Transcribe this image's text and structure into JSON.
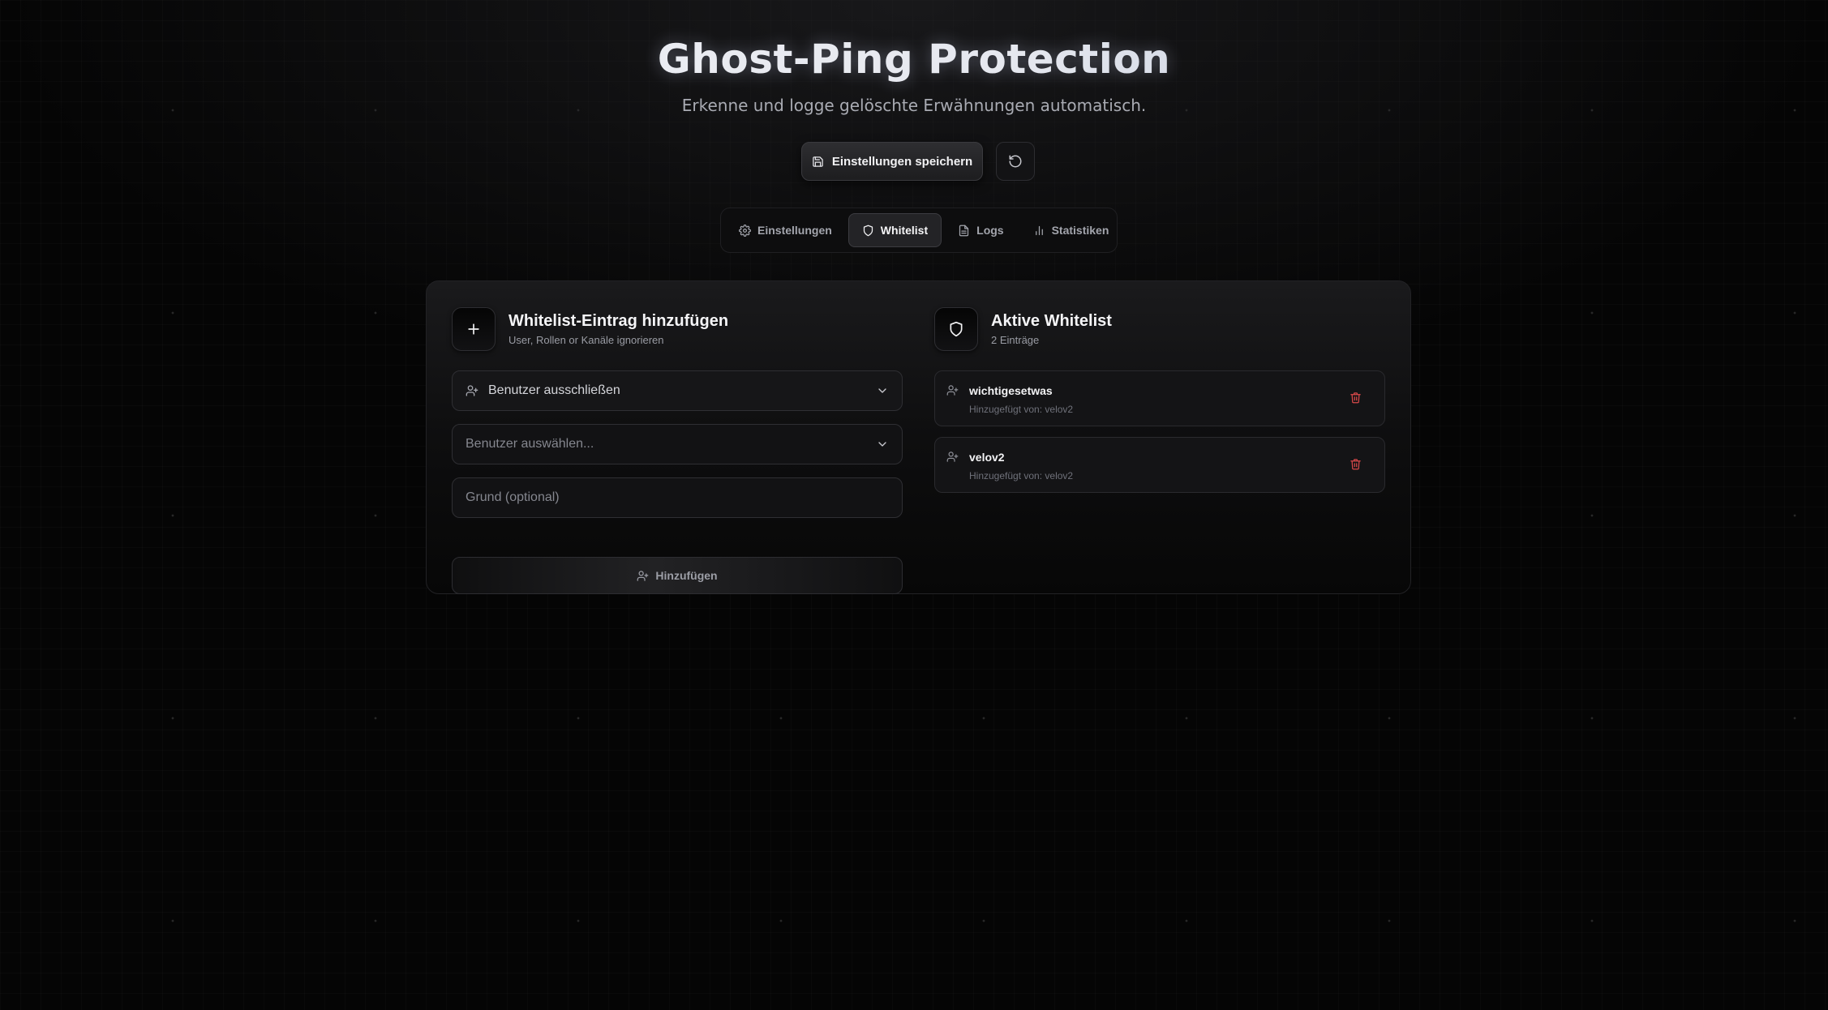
{
  "header": {
    "title": "Ghost-Ping Protection",
    "subtitle": "Erkenne und logge gelöschte Erwähnungen automatisch."
  },
  "actions": {
    "save_label": "Einstellungen speichern",
    "reset_icon": "refresh-icon"
  },
  "tabs": [
    {
      "label": "Einstellungen",
      "icon": "gear-icon",
      "active": false
    },
    {
      "label": "Whitelist",
      "icon": "shield-icon",
      "active": true
    },
    {
      "label": "Logs",
      "icon": "document-icon",
      "active": false
    },
    {
      "label": "Statistiken",
      "icon": "bar-chart-icon",
      "active": false
    }
  ],
  "add_section": {
    "title": "Whitelist-Eintrag hinzufügen",
    "subtitle": "User, Rollen or Kanäle ignorieren",
    "type_select": {
      "value": "Benutzer ausschließen"
    },
    "user_select": {
      "placeholder": "Benutzer auswählen..."
    },
    "reason_input": {
      "placeholder": "Grund (optional)"
    },
    "add_label": "Hinzufügen"
  },
  "whitelist": {
    "title": "Aktive Whitelist",
    "count_label": "2 Einträge",
    "entries": [
      {
        "name": "wichtigesetwas",
        "meta": "Hinzugefügt von: velov2"
      },
      {
        "name": "velov2",
        "meta": "Hinzugefügt von: velov2"
      }
    ]
  },
  "colors": {
    "background": "#050505",
    "panel": "#1a1a1c",
    "delete_icon": "#d9484a"
  }
}
